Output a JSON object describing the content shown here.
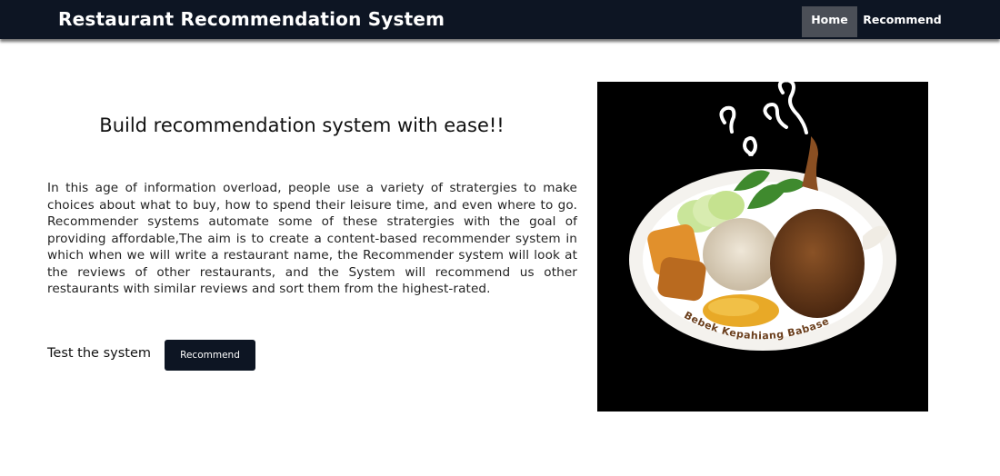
{
  "navbar": {
    "brand": "Restaurant Recommendation System",
    "home_label": "Home",
    "recommend_label": "Recommend"
  },
  "hero": {
    "headline": "Build recommendation system with ease!!",
    "description": "In this age of information overload, people use a variety of stratergies to make choices about what to buy, how to spend their leisure time, and even where to go. Recommender systems automate some of these stratergies with the goal of providing affordable,The aim is to create a content-based recommender system in which when we will write a restaurant name, the Recommender system will look at the reviews of other restaurants, and the System will recommend us other restaurants with similar reviews and sort them from the highest-rated.",
    "test_label": "Test the system",
    "button_label": "Recommend"
  },
  "image": {
    "plate_text": "Bebek Kepahiang Babase"
  },
  "colors": {
    "navbar_bg": "#0d1523",
    "home_active_bg": "#4b4f57",
    "button_bg": "#0d1523"
  }
}
